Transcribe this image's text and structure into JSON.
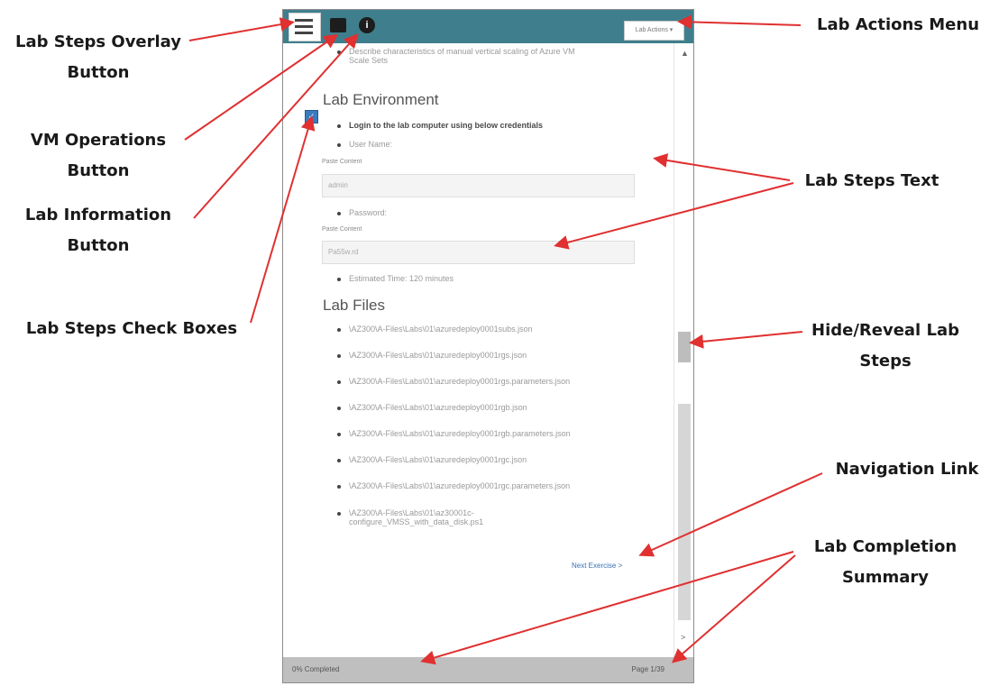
{
  "callouts": {
    "lab_steps_overlay": [
      "Lab Steps Overlay",
      "Button"
    ],
    "vm_operations": [
      "VM Operations",
      "Button"
    ],
    "lab_information": [
      "Lab Information",
      "Button"
    ],
    "lab_steps_checkboxes": "Lab Steps Check Boxes",
    "lab_actions_menu": "Lab Actions Menu",
    "lab_steps_text": "Lab Steps Text",
    "hide_reveal": [
      "Hide/Reveal Lab",
      "Steps"
    ],
    "navigation_link": "Navigation Link",
    "lab_completion": [
      "Lab Completion",
      "Summary"
    ]
  },
  "toolbar": {
    "info_glyph": "i",
    "actions_label": "Lab Actions ▾"
  },
  "content": {
    "intro_bullet": [
      "Describe characteristics of manual vertical scaling of Azure VM",
      "Scale Sets"
    ],
    "env_heading": "Lab Environment",
    "env_bullets": {
      "login": "Login to the lab computer using below credentials",
      "username": "User Name:",
      "password": "Password:",
      "time": "Estimated Time: 120 minutes"
    },
    "paste_label": "Paste Content",
    "username_value": "admin",
    "password_value": "Pa55w.rd",
    "files_heading": "Lab Files",
    "files": [
      "\\AZ300\\A-Files\\Labs\\01\\azuredeploy0001subs.json",
      "\\AZ300\\A-Files\\Labs\\01\\azuredeploy0001rgs.json",
      "\\AZ300\\A-Files\\Labs\\01\\azuredeploy0001rgs.parameters.json",
      "\\AZ300\\A-Files\\Labs\\01\\azuredeploy0001rgb.json",
      "\\AZ300\\A-Files\\Labs\\01\\azuredeploy0001rgb.parameters.json",
      "\\AZ300\\A-Files\\Labs\\01\\azuredeploy0001rgc.json",
      "\\AZ300\\A-Files\\Labs\\01\\azuredeploy0001rgc.parameters.json"
    ],
    "last_file": [
      "\\AZ300\\A-Files\\Labs\\01\\az30001c-",
      "configure_VMSS_with_data_disk.ps1"
    ],
    "next_link": "Next Exercise  >"
  },
  "footer": {
    "completion": "0% Completed",
    "page": "Page 1/39"
  },
  "colors": {
    "topbar": "#3f7f8d",
    "arrow": "#e03030",
    "link": "#3a6fb5",
    "footer": "#bfbfbf"
  },
  "icons": [
    "list-icon",
    "monitor-icon",
    "info-icon",
    "checkmark-icon",
    "chevron-up-icon",
    "chevron-right-icon"
  ]
}
